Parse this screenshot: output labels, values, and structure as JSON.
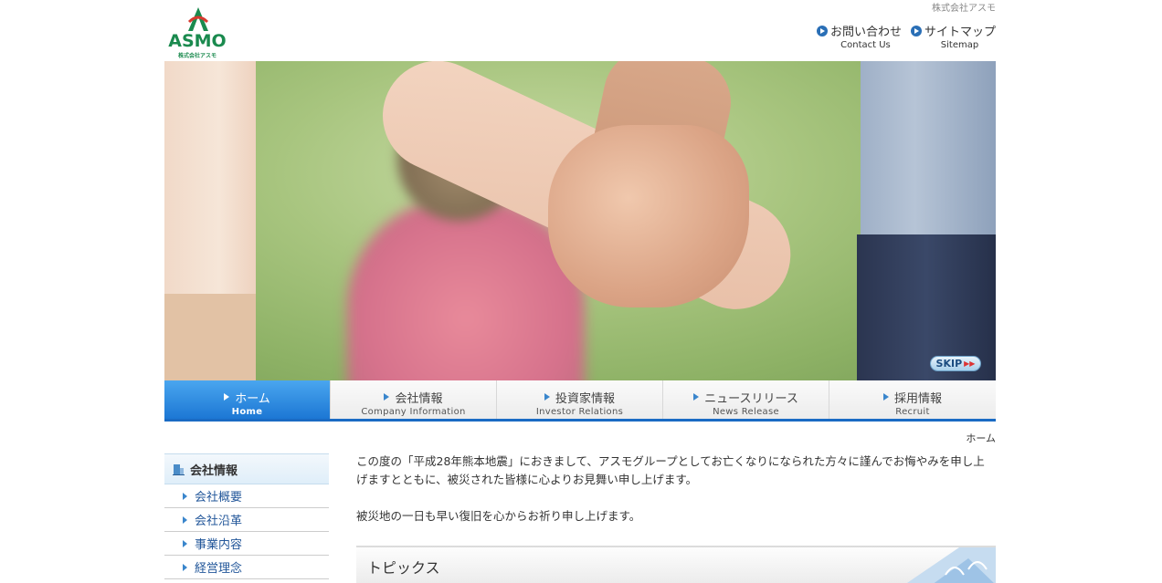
{
  "header": {
    "company_name": "株式会社アスモ",
    "logo_word": "ASMO",
    "logo_sub": "株式会社アスモ",
    "links": [
      {
        "jp": "お問い合わせ",
        "en": "Contact Us"
      },
      {
        "jp": "サイトマップ",
        "en": "Sitemap"
      }
    ]
  },
  "hero": {
    "skip_label": "SKIP"
  },
  "nav": [
    {
      "jp": "ホーム",
      "en": "Home",
      "active": true
    },
    {
      "jp": "会社情報",
      "en": "Company Information"
    },
    {
      "jp": "投資家情報",
      "en": "Investor Relations"
    },
    {
      "jp": "ニュースリリース",
      "en": "News Release"
    },
    {
      "jp": "採用情報",
      "en": "Recruit"
    }
  ],
  "breadcrumb": "ホーム",
  "sidebar": {
    "heading": "会社情報",
    "items": [
      "会社概要",
      "会社沿革",
      "事業内容",
      "経営理念"
    ]
  },
  "main": {
    "paragraph1": "この度の「平成28年熊本地震」におきまして、アスモグループとしてお亡くなりになられた方々に謹んでお悔やみを申し上げますとともに、被災された皆様に心よりお見舞い申し上げます。",
    "paragraph2": "被災地の一日も早い復旧を心からお祈り申し上げます。",
    "topics_title": "トピックス"
  },
  "colors": {
    "brand_green": "#1a8a4e",
    "logo_red": "#d83a2f",
    "nav_active": "#1c77d4",
    "link_blue": "#23579a"
  }
}
